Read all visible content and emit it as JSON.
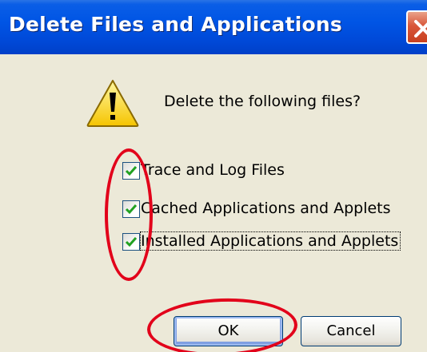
{
  "window": {
    "title": "Delete Files and Applications"
  },
  "dialog": {
    "prompt": "Delete the following files?",
    "options": [
      {
        "label": "Trace and Log Files",
        "checked": true
      },
      {
        "label": "Cached Applications and Applets",
        "checked": true
      },
      {
        "label": "Installed Applications and Applets",
        "checked": true
      }
    ],
    "buttons": {
      "ok": "OK",
      "cancel": "Cancel"
    }
  },
  "icons": {
    "warning": "warning-icon",
    "close": "close-icon",
    "checkmark": "checkmark-icon"
  },
  "colors": {
    "titlebar": "#0055e5",
    "close_button": "#d9573a",
    "annotation": "#e2001a",
    "checkmark": "#21a121"
  }
}
